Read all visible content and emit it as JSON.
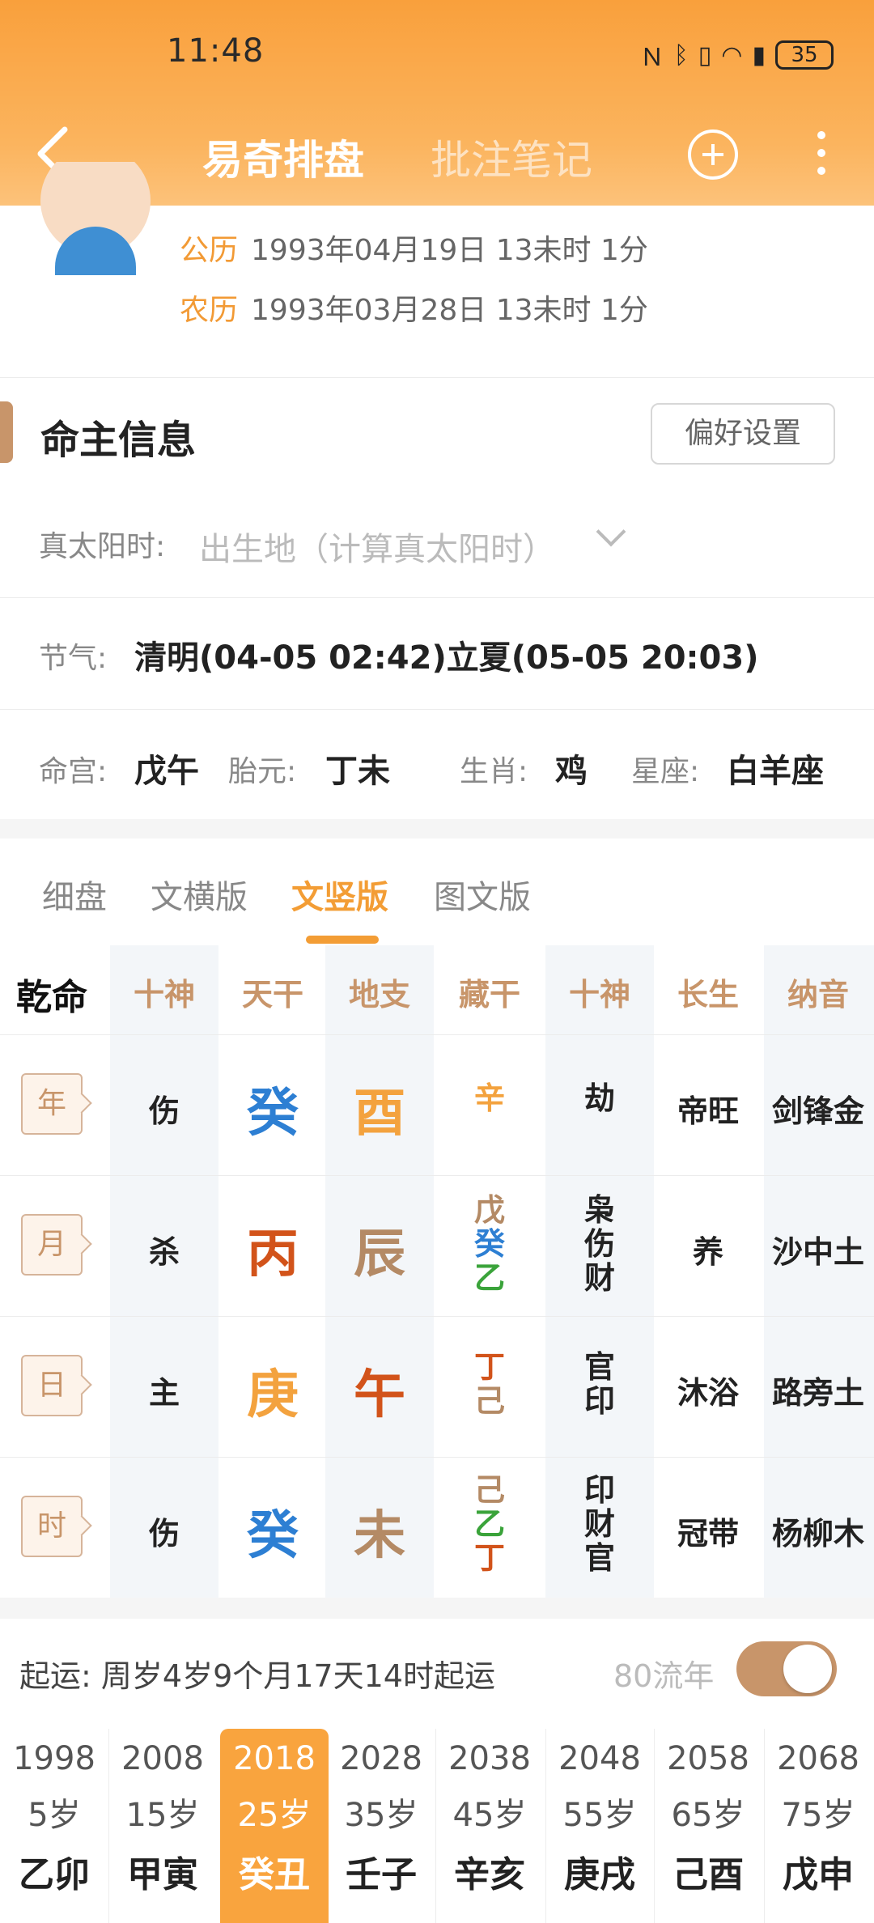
{
  "status": {
    "time": "11:48",
    "battery": "35"
  },
  "nav": {
    "tab_active": "易奇排盘",
    "tab_inactive": "批注笔记"
  },
  "dates": {
    "solar_label": "公历",
    "solar_value": "1993年04月19日 13未时 1分",
    "lunar_label": "农历",
    "lunar_value": "1993年03月28日 13未时 1分"
  },
  "info": {
    "title": "命主信息",
    "pref_button": "偏好设置",
    "true_solar_label": "真太阳时:",
    "true_solar_placeholder": "出生地（计算真太阳时）",
    "jieqi_label": "节气:",
    "jieqi_value": "清明(04-05 02:42)立夏(05-05 20:03)",
    "minggong_label": "命宫:",
    "minggong_value": "戊午",
    "taiyuan_label": "胎元:",
    "taiyuan_value": "丁未",
    "shengxiao_label": "生肖:",
    "shengxiao_value": "鸡",
    "xingzuo_label": "星座:",
    "xingzuo_value": "白羊座"
  },
  "subtabs": [
    "细盘",
    "文横版",
    "文竖版",
    "图文版"
  ],
  "grid": {
    "qianming": "乾命",
    "headers": [
      "十神",
      "天干",
      "地支",
      "藏干",
      "十神",
      "长生",
      "纳音"
    ],
    "rows": [
      {
        "tag": "年",
        "shishen": "伤",
        "tiangan": "癸",
        "dizhi": "酉",
        "canggan": [
          "辛"
        ],
        "shishen2": [
          "劫"
        ],
        "changsheng": "帝旺",
        "nayin": "剑锋金"
      },
      {
        "tag": "月",
        "shishen": "杀",
        "tiangan": "丙",
        "dizhi": "辰",
        "canggan": [
          "戊",
          "癸",
          "乙"
        ],
        "shishen2": [
          "枭",
          "伤",
          "财"
        ],
        "changsheng": "养",
        "nayin": "沙中土"
      },
      {
        "tag": "日",
        "shishen": "主",
        "tiangan": "庚",
        "dizhi": "午",
        "canggan": [
          "丁",
          "己"
        ],
        "shishen2": [
          "官",
          "印"
        ],
        "changsheng": "沐浴",
        "nayin": "路旁土"
      },
      {
        "tag": "时",
        "shishen": "伤",
        "tiangan": "癸",
        "dizhi": "未",
        "canggan": [
          "己",
          "乙",
          "丁"
        ],
        "shishen2": [
          "印",
          "财",
          "官"
        ],
        "changsheng": "冠带",
        "nayin": "杨柳木"
      }
    ]
  },
  "qiyun": {
    "label": "起运:",
    "value": "周岁4岁9个月17天14时起运",
    "liunian": "80流年"
  },
  "dayun": [
    {
      "year": "1998",
      "age": "5岁",
      "gz": "乙卯"
    },
    {
      "year": "2008",
      "age": "15岁",
      "gz": "甲寅"
    },
    {
      "year": "2018",
      "age": "25岁",
      "gz": "癸丑"
    },
    {
      "year": "2028",
      "age": "35岁",
      "gz": "壬子"
    },
    {
      "year": "2038",
      "age": "45岁",
      "gz": "辛亥"
    },
    {
      "year": "2048",
      "age": "55岁",
      "gz": "庚戌"
    },
    {
      "year": "2058",
      "age": "65岁",
      "gz": "己酉"
    },
    {
      "year": "2068",
      "age": "75岁",
      "gz": "戊申"
    }
  ],
  "colors": {
    "accent": "#f39d35",
    "tan": "#c8956a",
    "water": "#2d7fd3",
    "fire": "#d2531a",
    "earth": "#b48a65",
    "metal": "#f3a23e",
    "wood": "#3aa33a"
  }
}
